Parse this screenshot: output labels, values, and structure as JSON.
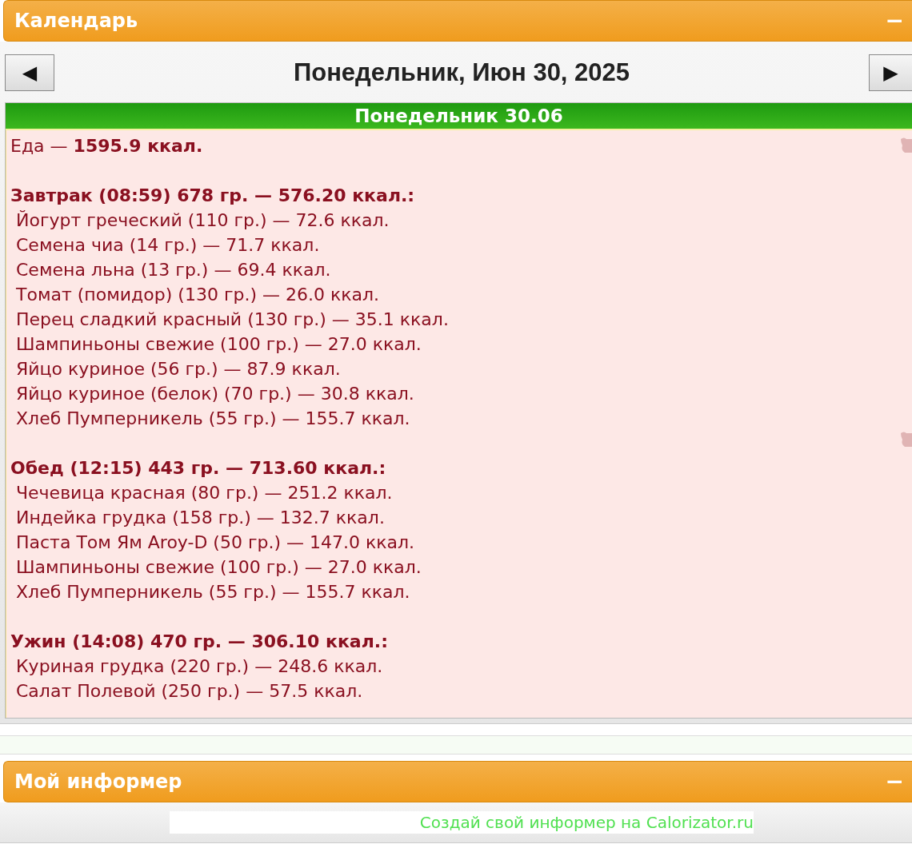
{
  "calendar_panel": {
    "title": "Календарь",
    "collapse": "−"
  },
  "date_nav": {
    "prev": "◀",
    "title": "Понедельник, Июн 30, 2025",
    "next": "▶"
  },
  "day": {
    "header": "Понедельник 30.06",
    "total": "Еда — **1595.9 ккал.**",
    "meals": [
      {
        "heading": "Завтрак (08:59) 678 гр. — 576.20 ккал.:",
        "items": [
          "Йогурт греческий (110 гр.) — 72.6 ккал.",
          "Семена чиа (14 гр.) — 71.7 ккал.",
          "Семена льна (13 гр.) — 69.4 ккал.",
          "Томат (помидор) (130 гр.) — 26.0 ккал.",
          "Перец сладкий красный (130 гр.) — 35.1 ккал.",
          "Шампиньоны свежие (100 гр.) — 27.0 ккал.",
          "Яйцо куриное (56 гр.) — 87.9 ккал.",
          "Яйцо куриное (белок) (70 гр.) — 30.8 ккал.",
          "Хлеб Пумперникель (55 гр.) — 155.7 ккал."
        ]
      },
      {
        "heading": "Обед (12:15) 443 гр. — 713.60 ккал.:",
        "items": [
          "Чечевица красная (80 гр.) — 251.2 ккал.",
          "Индейка грудка (158 гр.) — 132.7 ккал.",
          "Паста Том Ям Aroy-D (50 гр.) — 147.0 ккал.",
          "Шампиньоны свежие (100 гр.) — 27.0 ккал.",
          "Хлеб Пумперникель (55 гр.) — 155.7 ккал."
        ]
      },
      {
        "heading": "Ужин (14:08) 470 гр. — 306.10 ккал.:",
        "items": [
          "Куриная грудка (220 гр.) — 248.6 ккал.",
          "Салат Полевой (250 гр.) — 57.5 ккал."
        ]
      }
    ]
  },
  "informer_panel": {
    "title": "Мой информер",
    "collapse": "−",
    "link": "Создай свой информер на Calorizator.ru"
  }
}
